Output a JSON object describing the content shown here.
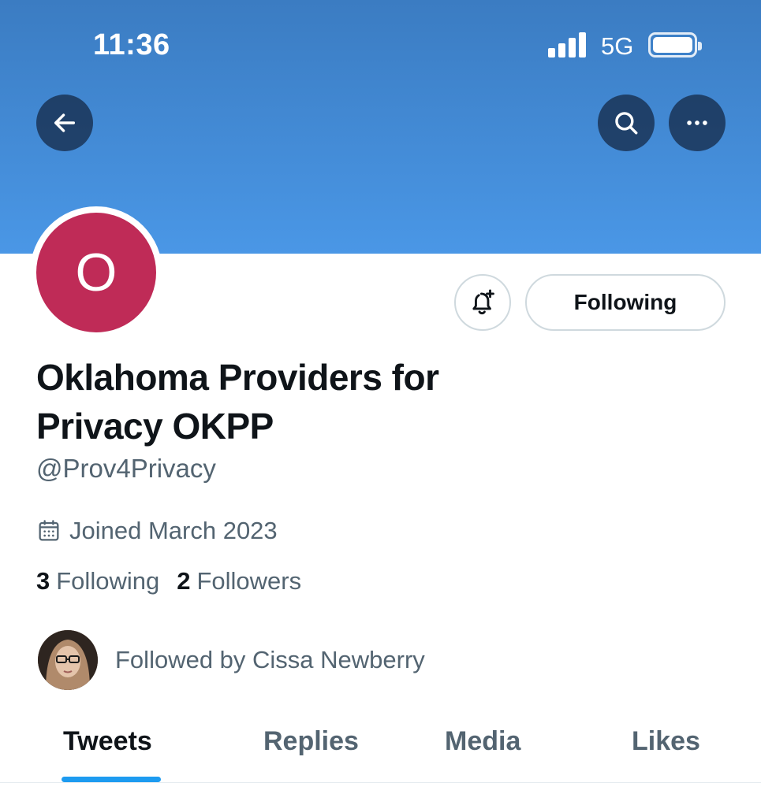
{
  "status_bar": {
    "time": "11:36",
    "network": "5G"
  },
  "header": {
    "back_icon": "arrow-left-icon",
    "search_icon": "search-icon",
    "more_icon": "more-horizontal-icon",
    "banner_color": "#4a97e6"
  },
  "profile": {
    "avatar_letter": "O",
    "avatar_color": "#bf2b57",
    "display_name": "Oklahoma Providers for Privacy OKPP",
    "handle": "@Prov4Privacy",
    "joined": "Joined March 2023",
    "following_count": "3",
    "following_label": "Following",
    "followers_count": "2",
    "followers_label": "Followers",
    "followed_by": "Followed by Cissa Newberry"
  },
  "actions": {
    "notify_icon": "bell-plus-icon",
    "following_button": "Following"
  },
  "tabs": [
    {
      "label": "Tweets",
      "active": true
    },
    {
      "label": "Replies",
      "active": false
    },
    {
      "label": "Media",
      "active": false
    },
    {
      "label": "Likes",
      "active": false
    }
  ],
  "colors": {
    "accent": "#1d9bf0",
    "text_primary": "#0f1419",
    "text_secondary": "#536471"
  }
}
